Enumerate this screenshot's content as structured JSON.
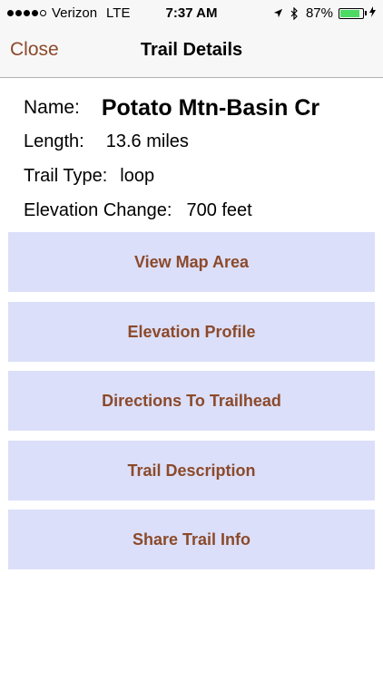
{
  "status_bar": {
    "carrier": "Verizon",
    "network": "LTE",
    "time": "7:37 AM",
    "battery_percent": "87%",
    "battery_level": 0.87,
    "battery_color": "#4cd964",
    "icons": [
      "signal-dots-icon",
      "location-arrow-icon",
      "bluetooth-icon",
      "battery-icon",
      "charging-bolt-icon"
    ]
  },
  "nav": {
    "close_label": "Close",
    "title": "Trail Details"
  },
  "details": {
    "name_label": "Name:",
    "name_value": "Potato Mtn-Basin Cr",
    "length_label": "Length:",
    "length_value": "13.6 miles",
    "type_label": "Trail Type:",
    "type_value": "loop",
    "elevation_label": "Elevation Change:",
    "elevation_value": "700 feet"
  },
  "buttons": {
    "view_map": "View Map Area",
    "elevation_profile": "Elevation Profile",
    "directions": "Directions To Trailhead",
    "description": "Trail Description",
    "share": "Share Trail Info"
  },
  "colors": {
    "accent": "#8b4a2b",
    "button_bg": "#dcdff9",
    "nav_bg": "#f7f7f7"
  }
}
